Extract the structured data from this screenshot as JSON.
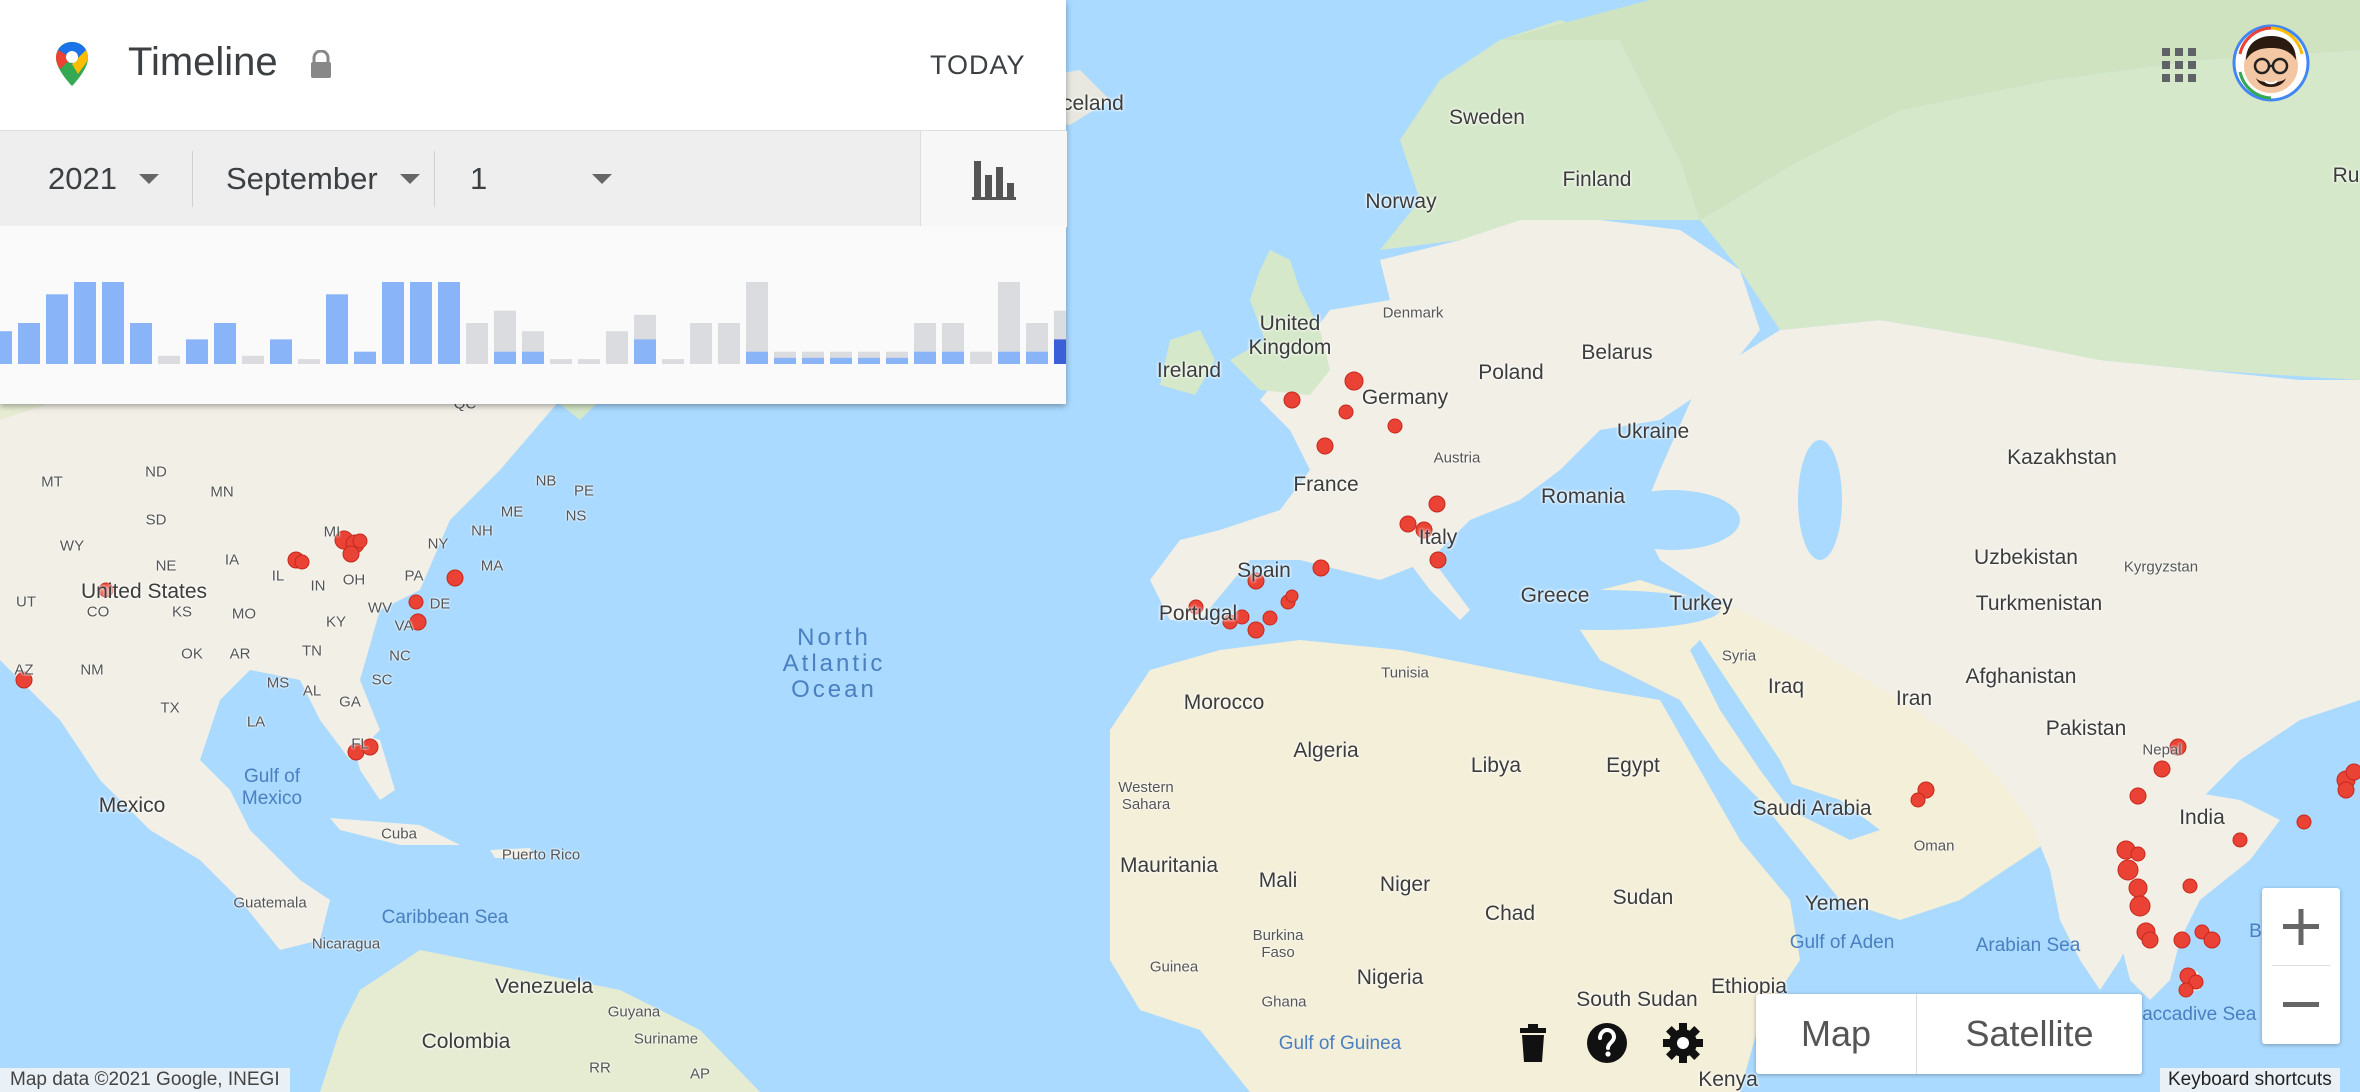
{
  "timeline": {
    "title": "Timeline",
    "today_label": "TODAY",
    "year": "2021",
    "month": "September",
    "day": "1",
    "histogram_levels": [
      0.4,
      0.5,
      0.85,
      1,
      1,
      0.5,
      0.1,
      0.3,
      0.5,
      0.1,
      0.3,
      0.06,
      0.85,
      0.15,
      1,
      1,
      1,
      0.5,
      0.65,
      0.4,
      0.06,
      0.06,
      0.4,
      0.6,
      0.06,
      0.5,
      0.5,
      1,
      0.15,
      0.15,
      0.15,
      0.15,
      0.15,
      0.5,
      0.5,
      0.15,
      1,
      0.5,
      0.65
    ],
    "histogram_highlight": [
      1,
      1,
      1,
      1,
      1,
      1,
      0,
      1,
      1,
      0,
      1,
      0,
      1,
      1,
      1,
      1,
      1,
      0,
      0.3,
      0.3,
      0,
      0,
      0,
      0.6,
      0,
      0,
      0,
      0.3,
      0.15,
      0.15,
      0.15,
      0.15,
      0.15,
      0.3,
      0.3,
      0,
      0.3,
      0.3,
      0.6
    ],
    "selected_index": 38
  },
  "map": {
    "type_buttons": [
      "Map",
      "Satellite"
    ],
    "attribution": "Map data ©2021 Google, INEGI",
    "keyboard_shortcuts": "Keyboard shortcuts",
    "countries": [
      "Iceland",
      "Sweden",
      "Finland",
      "Norway",
      "Denmark",
      "United Kingdom",
      "Ireland",
      "Germany",
      "Poland",
      "Belarus",
      "Ukraine",
      "Austria",
      "France",
      "Romania",
      "Kazakhstan",
      "Italy",
      "Spain",
      "Portugal",
      "Greece",
      "Turkey",
      "Uzbekistan",
      "Kyrgyzstan",
      "Turkmenistan",
      "Tunisia",
      "Syria",
      "Iraq",
      "Iran",
      "Afghanistan",
      "Pakistan",
      "Morocco",
      "Algeria",
      "Libya",
      "Egypt",
      "Western Sahara",
      "Saudi Arabia",
      "Oman",
      "Nepal",
      "India",
      "Mauritania",
      "Mali",
      "Niger",
      "Chad",
      "Sudan",
      "Yemen",
      "Burkina Faso",
      "Guinea",
      "Nigeria",
      "Ghana",
      "South Sudan",
      "Ethiopia",
      "Kenya",
      "Mexico",
      "Cuba",
      "Puerto Rico",
      "Guatemala",
      "Nicaragua",
      "Venezuela",
      "Guyana",
      "Suriname",
      "Colombia",
      "United States",
      "Ru"
    ],
    "states": [
      "MT",
      "ND",
      "MN",
      "WY",
      "SD",
      "NE",
      "IA",
      "UT",
      "CO",
      "KS",
      "MO",
      "IL",
      "IN",
      "OH",
      "MI",
      "NY",
      "PA",
      "NH",
      "ME",
      "NB",
      "PE",
      "NS",
      "MA",
      "DE",
      "KY",
      "WV",
      "VA",
      "NC",
      "TN",
      "SC",
      "OK",
      "AZ",
      "NM",
      "TX",
      "AR",
      "MS",
      "AL",
      "GA",
      "LA",
      "FL",
      "RR",
      "AP",
      "QC"
    ],
    "water": [
      "Gulf of Mexico",
      "Caribbean Sea",
      "Gulf of Guinea",
      "Gulf of Aden",
      "Arabian Sea",
      "Bay of",
      "Laccadive Sea"
    ],
    "ocean": "North Atlantic Ocean"
  },
  "colors": {
    "accent": "#4285f4",
    "histogram_bar": "#8ab4f8",
    "histogram_selected": "#3b5fd6",
    "histogram_empty": "#dadce0",
    "marker": "#ea4335",
    "land": "#f1efe6",
    "water": "#aadaff"
  },
  "icons": [
    "maps-pin-icon",
    "lock-icon",
    "chart-icon",
    "apps-grid-icon",
    "avatar",
    "trash-icon",
    "help-icon",
    "gear-icon",
    "zoom-in-icon",
    "zoom-out-icon"
  ]
}
